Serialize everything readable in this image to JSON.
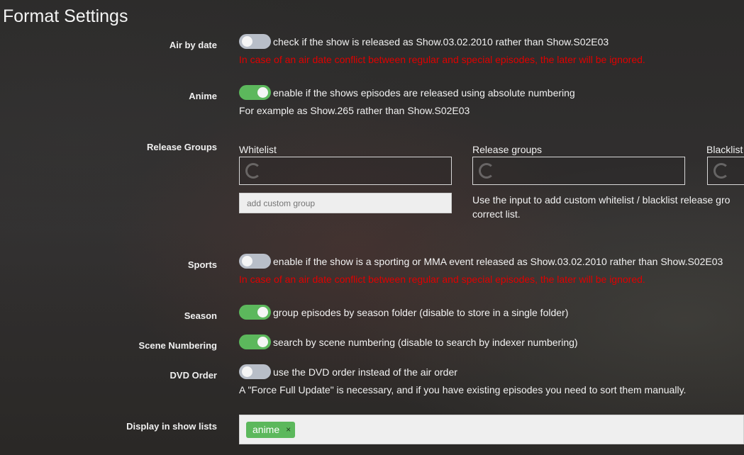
{
  "page": {
    "title": "Format Settings"
  },
  "air_by_date": {
    "label": "Air by date",
    "enabled": false,
    "description": "check if the show is released as Show.03.02.2010 rather than Show.S02E03",
    "warning": "In case of an air date conflict between regular and special episodes, the later will be ignored."
  },
  "anime": {
    "label": "Anime",
    "enabled": true,
    "description": "enable if the shows episodes are released using absolute numbering",
    "note": "For example as Show.265 rather than Show.S02E03"
  },
  "release_groups": {
    "label": "Release Groups",
    "whitelist_title": "Whitelist",
    "groups_title": "Release groups",
    "blacklist_title": "Blacklist",
    "custom_placeholder": "add custom group",
    "help_line1": "Use the input to add custom whitelist / blacklist release gro",
    "help_line2": "correct list."
  },
  "sports": {
    "label": "Sports",
    "enabled": false,
    "description": "enable if the show is a sporting or MMA event released as Show.03.02.2010 rather than Show.S02E03",
    "warning": "In case of an air date conflict between regular and special episodes, the later will be ignored."
  },
  "season": {
    "label": "Season",
    "enabled": true,
    "description": "group episodes by season folder (disable to store in a single folder)"
  },
  "scene_numbering": {
    "label": "Scene Numbering",
    "enabled": true,
    "description": "search by scene numbering (disable to search by indexer numbering)"
  },
  "dvd_order": {
    "label": "DVD Order",
    "enabled": false,
    "description": "use the DVD order instead of the air order",
    "note": "A \"Force Full Update\" is necessary, and if you have existing episodes you need to sort them manually."
  },
  "show_lists": {
    "label": "Display in show lists",
    "tags": [
      {
        "label": "anime",
        "remove": "×"
      }
    ]
  },
  "colors": {
    "toggle_on": "#5cb85c",
    "toggle_off": "#b8bec8",
    "warning": "#e00000"
  }
}
